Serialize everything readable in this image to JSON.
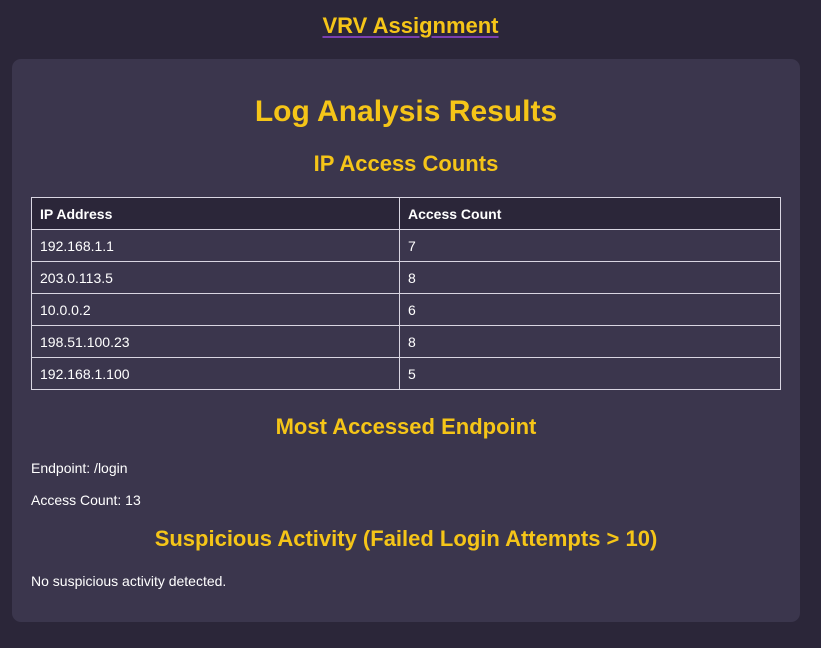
{
  "header": {
    "title": "VRV Assignment"
  },
  "main": {
    "title": "Log Analysis Results",
    "ip_section": {
      "heading": "IP Access Counts",
      "columns": [
        "IP Address",
        "Access Count"
      ],
      "rows": [
        {
          "ip": "192.168.1.1",
          "count": "7"
        },
        {
          "ip": "203.0.113.5",
          "count": "8"
        },
        {
          "ip": "10.0.0.2",
          "count": "6"
        },
        {
          "ip": "198.51.100.23",
          "count": "8"
        },
        {
          "ip": "192.168.1.100",
          "count": "5"
        }
      ]
    },
    "endpoint_section": {
      "heading": "Most Accessed Endpoint",
      "endpoint_line": "Endpoint: /login",
      "count_line": "Access Count: 13"
    },
    "suspicious_section": {
      "heading": "Suspicious Activity (Failed Login Attempts > 10)",
      "message": "No suspicious activity detected."
    }
  },
  "colors": {
    "page_background": "#2b2639",
    "card_background": "#3b364d",
    "accent": "#f5c518",
    "link_underline": "#7a3fb0",
    "text": "#ffffff"
  }
}
